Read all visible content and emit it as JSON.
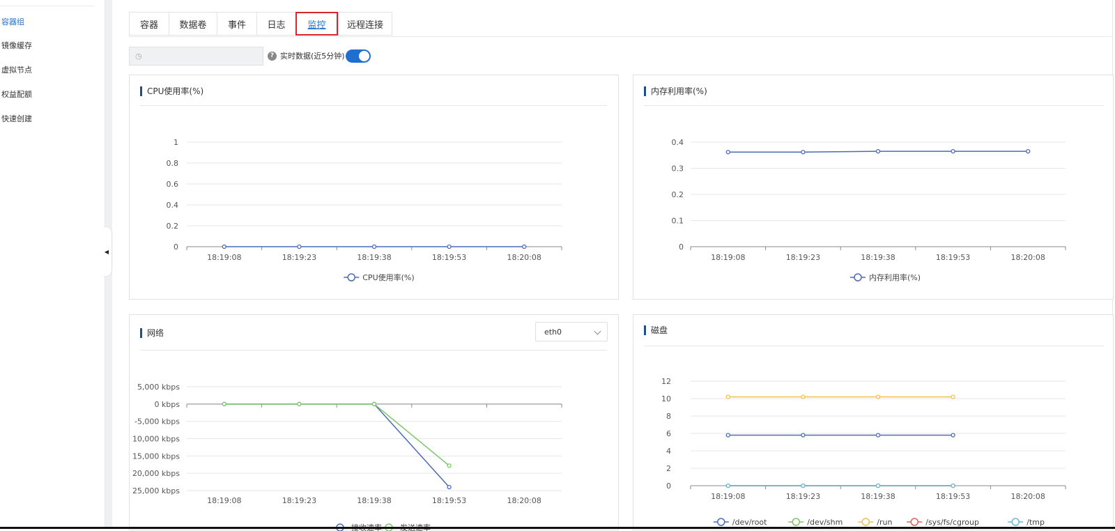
{
  "sidebar": {
    "items": [
      {
        "label": "容器组",
        "active": true
      },
      {
        "label": "镜像缓存",
        "active": false
      },
      {
        "label": "虚拟节点",
        "active": false
      },
      {
        "label": "权益配额",
        "active": false
      },
      {
        "label": "快速创建",
        "active": false
      }
    ]
  },
  "tabs": [
    {
      "label": "容器",
      "active": false
    },
    {
      "label": "数据卷",
      "active": false
    },
    {
      "label": "事件",
      "active": false
    },
    {
      "label": "日志",
      "active": false
    },
    {
      "label": "监控",
      "active": true
    },
    {
      "label": "远程连接",
      "active": false
    }
  ],
  "toolbar": {
    "time_range_value": "",
    "realtime_label": "实时数据(近5分钟)",
    "realtime_on": true
  },
  "network": {
    "interface": "eth0"
  },
  "colors": {
    "accent": "#1f6fd1",
    "series_blue": "#4a6bb5",
    "series_green": "#7cc56a",
    "series_yellow": "#f2c04a",
    "series_red": "#e0605d",
    "series_cyan": "#6ab8d6"
  },
  "chart_data": [
    {
      "id": "cpu",
      "type": "line",
      "title": "CPU使用率(%)",
      "x": [
        "18:19:08",
        "18:19:23",
        "18:19:38",
        "18:19:53",
        "18:20:08"
      ],
      "y_ticks": [
        "0",
        "0.2",
        "0.4",
        "0.6",
        "0.8",
        "1"
      ],
      "ylim": [
        0,
        1
      ],
      "series": [
        {
          "name": "CPU使用率(%)",
          "color": "#4a6bb5",
          "values": [
            0,
            0,
            0,
            0,
            0
          ]
        }
      ],
      "legend": "bottom"
    },
    {
      "id": "mem",
      "type": "line",
      "title": "内存利用率(%)",
      "x": [
        "18:19:08",
        "18:19:23",
        "18:19:38",
        "18:19:53",
        "18:20:08"
      ],
      "y_ticks": [
        "0",
        "0.1",
        "0.2",
        "0.3",
        "0.4"
      ],
      "ylim": [
        0,
        0.4
      ],
      "series": [
        {
          "name": "内存利用率(%)",
          "color": "#4a6bb5",
          "values": [
            0.362,
            0.362,
            0.365,
            0.365,
            0.365
          ]
        }
      ],
      "legend": "bottom"
    },
    {
      "id": "net",
      "type": "line",
      "title": "网络",
      "x": [
        "18:19:08",
        "18:19:23",
        "18:19:38",
        "18:19:53",
        "18:20:08"
      ],
      "y_ticks": [
        "5,000 kbps",
        "0 kbps",
        "-5,000 kbps",
        "10,000 kbps",
        "15,000 kbps",
        "20,000 kbps",
        "25,000 kbps"
      ],
      "y_tick_values": [
        5000,
        0,
        -5000,
        -10000,
        -15000,
        -20000,
        -25000
      ],
      "ylim": [
        -25000,
        5000
      ],
      "series": [
        {
          "name": "接收速率",
          "color": "#4a6bb5",
          "values": [
            0,
            0,
            0,
            -24000
          ]
        },
        {
          "name": "发送速率",
          "color": "#7cc56a",
          "values": [
            0,
            0,
            0,
            -17800
          ]
        }
      ],
      "legend": "bottom"
    },
    {
      "id": "disk",
      "type": "line",
      "title": "磁盘",
      "x": [
        "18:19:08",
        "18:19:23",
        "18:19:38",
        "18:19:53",
        "18:20:08"
      ],
      "y_ticks": [
        "0",
        "2",
        "4",
        "6",
        "8",
        "10",
        "12"
      ],
      "ylim": [
        0,
        12
      ],
      "series": [
        {
          "name": "/dev/root",
          "color": "#4a6bb5",
          "values": [
            5.8,
            5.8,
            5.8,
            5.8
          ]
        },
        {
          "name": "/dev/shm",
          "color": "#7cc56a",
          "values": [
            0,
            0,
            0,
            0
          ]
        },
        {
          "name": "/run",
          "color": "#f2c04a",
          "values": [
            10.2,
            10.2,
            10.2,
            10.2
          ]
        },
        {
          "name": "/sys/fs/cgroup",
          "color": "#e0605d",
          "values": [
            0,
            0,
            0,
            0
          ]
        },
        {
          "name": "/tmp",
          "color": "#6ab8d6",
          "values": [
            0,
            0,
            0,
            0
          ]
        }
      ],
      "legend": "bottom"
    }
  ]
}
